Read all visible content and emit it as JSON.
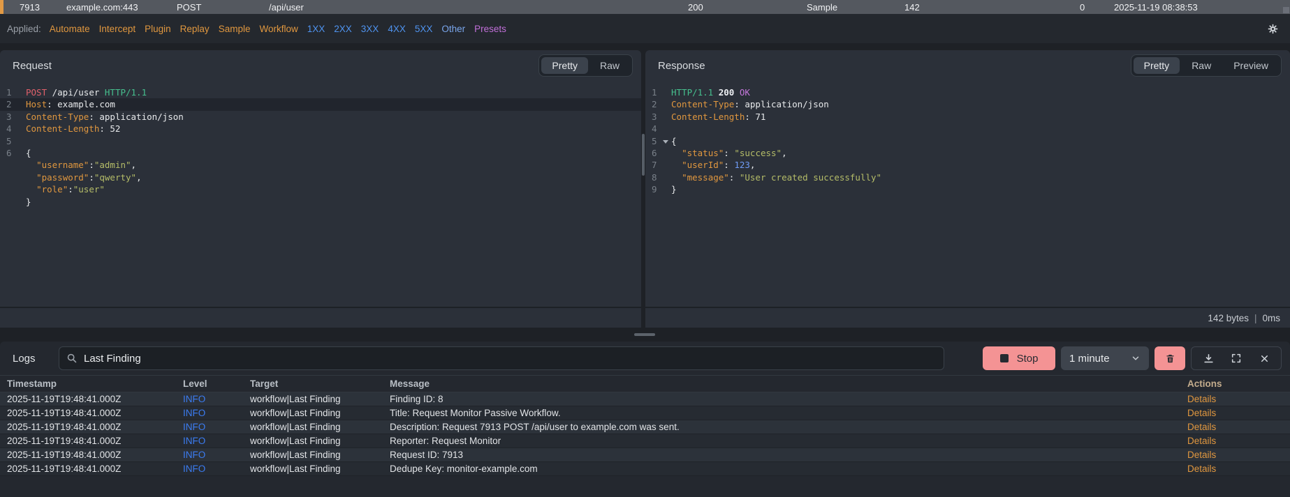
{
  "request_row": {
    "id": "7913",
    "host": "example.com:443",
    "method": "POST",
    "path": "/api/user",
    "status_code": "200",
    "source": "Sample",
    "size": "142",
    "extra": "0",
    "timestamp": "2025-11-19 08:38:53",
    "accent_color": "#e29a45"
  },
  "filter_bar": {
    "label": "Applied:",
    "workflow_filters": [
      "Automate",
      "Intercept",
      "Plugin",
      "Replay",
      "Sample",
      "Workflow"
    ],
    "status_filters": [
      "1XX",
      "2XX",
      "3XX",
      "4XX",
      "5XX"
    ],
    "other_label": "Other",
    "presets_label": "Presets"
  },
  "request_panel": {
    "title": "Request",
    "tabs": [
      "Pretty",
      "Raw"
    ],
    "active_tab": "Pretty",
    "lines": [
      {
        "num": "1",
        "tokens": [
          [
            "POST",
            "method"
          ],
          [
            " /api/user ",
            "plain"
          ],
          [
            "HTTP/1.1",
            "version"
          ]
        ]
      },
      {
        "num": "2",
        "hl": true,
        "tokens": [
          [
            "Host",
            "hkey"
          ],
          [
            ": example.com",
            "plain"
          ]
        ]
      },
      {
        "num": "3",
        "tokens": [
          [
            "Content-Type",
            "hkey"
          ],
          [
            ": application/json",
            "plain"
          ]
        ]
      },
      {
        "num": "4",
        "tokens": [
          [
            "Content-Length",
            "hkey"
          ],
          [
            ": 52",
            "plain"
          ]
        ]
      },
      {
        "num": "5",
        "tokens": []
      },
      {
        "num": "6",
        "tokens": [
          [
            "{",
            "plain"
          ]
        ]
      },
      {
        "num": "",
        "tokens": [
          [
            "  ",
            "plain"
          ],
          [
            "\"username\"",
            "jkey"
          ],
          [
            ":",
            "plain"
          ],
          [
            "\"admin\"",
            "jstr"
          ],
          [
            ",",
            "plain"
          ]
        ]
      },
      {
        "num": "",
        "tokens": [
          [
            "  ",
            "plain"
          ],
          [
            "\"password\"",
            "jkey"
          ],
          [
            ":",
            "plain"
          ],
          [
            "\"qwerty\"",
            "jstr"
          ],
          [
            ",",
            "plain"
          ]
        ]
      },
      {
        "num": "",
        "tokens": [
          [
            "  ",
            "plain"
          ],
          [
            "\"role\"",
            "jkey"
          ],
          [
            ":",
            "plain"
          ],
          [
            "\"user\"",
            "jstr"
          ]
        ]
      },
      {
        "num": "",
        "tokens": [
          [
            "}",
            "plain"
          ]
        ]
      }
    ]
  },
  "response_panel": {
    "title": "Response",
    "tabs": [
      "Pretty",
      "Raw",
      "Preview"
    ],
    "active_tab": "Pretty",
    "lines": [
      {
        "num": "1",
        "tokens": [
          [
            "HTTP/1.1",
            "version"
          ],
          [
            " ",
            "plain"
          ],
          [
            "200",
            "status"
          ],
          [
            " ",
            "plain"
          ],
          [
            "OK",
            "ok"
          ]
        ]
      },
      {
        "num": "2",
        "tokens": [
          [
            "Content-Type",
            "hkey"
          ],
          [
            ": application/json",
            "plain"
          ]
        ]
      },
      {
        "num": "3",
        "tokens": [
          [
            "Content-Length",
            "hkey"
          ],
          [
            ": 71",
            "plain"
          ]
        ]
      },
      {
        "num": "4",
        "tokens": []
      },
      {
        "num": "5",
        "fold": true,
        "tokens": [
          [
            "{",
            "plain"
          ]
        ]
      },
      {
        "num": "6",
        "tokens": [
          [
            "  ",
            "plain"
          ],
          [
            "\"status\"",
            "jkey"
          ],
          [
            ": ",
            "plain"
          ],
          [
            "\"success\"",
            "jstr"
          ],
          [
            ",",
            "plain"
          ]
        ]
      },
      {
        "num": "7",
        "tokens": [
          [
            "  ",
            "plain"
          ],
          [
            "\"userId\"",
            "jkey"
          ],
          [
            ": ",
            "plain"
          ],
          [
            "123",
            "num"
          ],
          [
            ",",
            "plain"
          ]
        ]
      },
      {
        "num": "8",
        "tokens": [
          [
            "  ",
            "plain"
          ],
          [
            "\"message\"",
            "jkey"
          ],
          [
            ": ",
            "plain"
          ],
          [
            "\"User created successfully\"",
            "jstr"
          ]
        ]
      },
      {
        "num": "9",
        "tokens": [
          [
            "}",
            "plain"
          ]
        ]
      }
    ],
    "footer": {
      "size": "142 bytes",
      "separator": "|",
      "time": "0ms"
    }
  },
  "logs": {
    "title": "Logs",
    "search_value": "Last Finding",
    "stop_button_label": "Stop",
    "interval_value": "1 minute",
    "columns": [
      "Timestamp",
      "Level",
      "Target",
      "Message",
      "Actions"
    ],
    "rows": [
      {
        "timestamp": "2025-11-19T19:48:41.000Z",
        "level": "INFO",
        "target": "workflow|Last Finding",
        "message": "Finding ID: 8",
        "action": "Details"
      },
      {
        "timestamp": "2025-11-19T19:48:41.000Z",
        "level": "INFO",
        "target": "workflow|Last Finding",
        "message": "Title: Request Monitor Passive Workflow.",
        "action": "Details"
      },
      {
        "timestamp": "2025-11-19T19:48:41.000Z",
        "level": "INFO",
        "target": "workflow|Last Finding",
        "message": "Description: Request 7913 POST /api/user to example.com was sent.",
        "action": "Details"
      },
      {
        "timestamp": "2025-11-19T19:48:41.000Z",
        "level": "INFO",
        "target": "workflow|Last Finding",
        "message": "Reporter: Request Monitor",
        "action": "Details"
      },
      {
        "timestamp": "2025-11-19T19:48:41.000Z",
        "level": "INFO",
        "target": "workflow|Last Finding",
        "message": "Request ID: 7913",
        "action": "Details"
      },
      {
        "timestamp": "2025-11-19T19:48:41.000Z",
        "level": "INFO",
        "target": "workflow|Last Finding",
        "message": "Dedupe Key: monitor-example.com",
        "action": "Details"
      }
    ],
    "accent_colors": {
      "info_level": "#3b7cf2",
      "details_link": "#e0973f",
      "stop_button": "#f49394"
    }
  }
}
